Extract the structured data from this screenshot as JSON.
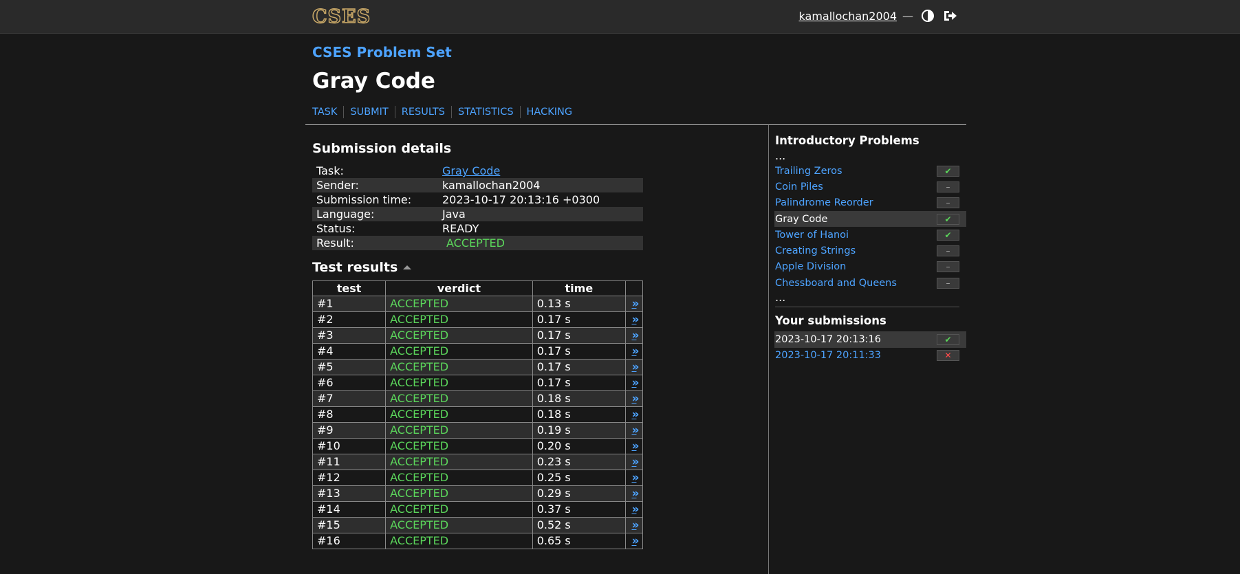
{
  "header": {
    "logo_text": "CSES",
    "username": "kamallochan2004",
    "dash": "—",
    "theme_icon": "half-circle-icon",
    "logout_icon": "logout-icon"
  },
  "problem_set_title": "CSES Problem Set",
  "task_title": "Gray Code",
  "nav": [
    "TASK",
    "SUBMIT",
    "RESULTS",
    "STATISTICS",
    "HACKING"
  ],
  "details": {
    "heading": "Submission details",
    "rows": [
      {
        "key": "Task:",
        "value": "Gray Code",
        "link": true
      },
      {
        "key": "Sender:",
        "value": "kamallochan2004"
      },
      {
        "key": "Submission time:",
        "value": "2023-10-17 20:13:16 +0300"
      },
      {
        "key": "Language:",
        "value": "Java"
      },
      {
        "key": "Status:",
        "value": "READY"
      },
      {
        "key": "Result:",
        "value": "ACCEPTED",
        "badge": true
      }
    ]
  },
  "tests": {
    "heading": "Test results",
    "columns": [
      "test",
      "verdict",
      "time"
    ],
    "rows": [
      {
        "test": "#1",
        "verdict": "ACCEPTED",
        "time": "0.13 s"
      },
      {
        "test": "#2",
        "verdict": "ACCEPTED",
        "time": "0.17 s"
      },
      {
        "test": "#3",
        "verdict": "ACCEPTED",
        "time": "0.17 s"
      },
      {
        "test": "#4",
        "verdict": "ACCEPTED",
        "time": "0.17 s"
      },
      {
        "test": "#5",
        "verdict": "ACCEPTED",
        "time": "0.17 s"
      },
      {
        "test": "#6",
        "verdict": "ACCEPTED",
        "time": "0.17 s"
      },
      {
        "test": "#7",
        "verdict": "ACCEPTED",
        "time": "0.18 s"
      },
      {
        "test": "#8",
        "verdict": "ACCEPTED",
        "time": "0.18 s"
      },
      {
        "test": "#9",
        "verdict": "ACCEPTED",
        "time": "0.19 s"
      },
      {
        "test": "#10",
        "verdict": "ACCEPTED",
        "time": "0.20 s"
      },
      {
        "test": "#11",
        "verdict": "ACCEPTED",
        "time": "0.23 s"
      },
      {
        "test": "#12",
        "verdict": "ACCEPTED",
        "time": "0.25 s"
      },
      {
        "test": "#13",
        "verdict": "ACCEPTED",
        "time": "0.29 s"
      },
      {
        "test": "#14",
        "verdict": "ACCEPTED",
        "time": "0.37 s"
      },
      {
        "test": "#15",
        "verdict": "ACCEPTED",
        "time": "0.52 s"
      },
      {
        "test": "#16",
        "verdict": "ACCEPTED",
        "time": "0.65 s"
      }
    ],
    "link_glyph": "»"
  },
  "sidebar": {
    "section_title": "Introductory Problems",
    "ellipsis": "...",
    "problems": [
      {
        "name": "Trailing Zeros",
        "status": "solved"
      },
      {
        "name": "Coin Piles",
        "status": "none"
      },
      {
        "name": "Palindrome Reorder",
        "status": "none"
      },
      {
        "name": "Gray Code",
        "status": "solved",
        "current": true
      },
      {
        "name": "Tower of Hanoi",
        "status": "solved"
      },
      {
        "name": "Creating Strings",
        "status": "none"
      },
      {
        "name": "Apple Division",
        "status": "none"
      },
      {
        "name": "Chessboard and Queens",
        "status": "none"
      }
    ],
    "submissions_title": "Your submissions",
    "submissions": [
      {
        "time": "2023-10-17 20:13:16",
        "status": "solved",
        "current": true
      },
      {
        "time": "2023-10-17 20:11:33",
        "status": "fail"
      }
    ]
  },
  "colors": {
    "accent": "#4da3ff",
    "accepted": "#5bd65b",
    "failed": "#ff4a4a",
    "logo": "#c9a867"
  }
}
